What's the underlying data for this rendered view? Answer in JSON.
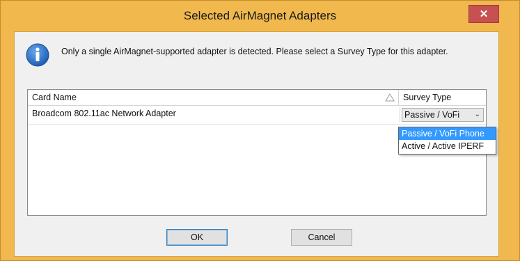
{
  "window": {
    "title": "Selected AirMagnet Adapters",
    "close_glyph": "✕"
  },
  "message": {
    "icon": "info-icon",
    "text": "Only a single AirMagnet-supported adapter is detected.  Please select a Survey Type for this adapter."
  },
  "grid": {
    "columns": [
      "Card Name",
      "Survey Type"
    ],
    "sort_glyph": "△",
    "rows": [
      {
        "card_name": "Broadcom 802.11ac Network Adapter",
        "survey_type": "Passive / VoFi"
      }
    ]
  },
  "dropdown": {
    "arrow_glyph": "⌄",
    "options": [
      "Passive / VoFi Phone",
      "Active / Active IPERF"
    ],
    "highlighted_index": 0
  },
  "buttons": {
    "ok": "OK",
    "cancel": "Cancel"
  },
  "colors": {
    "title_bar": "#f0b84d",
    "close_button": "#c75050",
    "selection": "#3399ff",
    "info_icon": "#1f5fb4"
  }
}
